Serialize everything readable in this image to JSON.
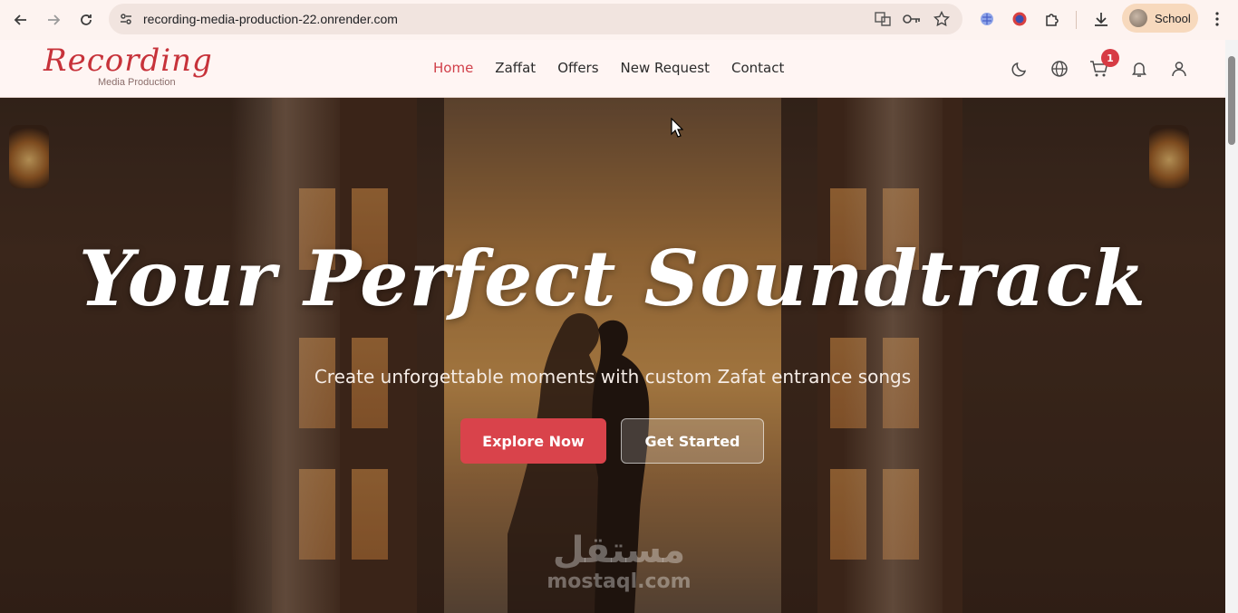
{
  "browser": {
    "url": "recording-media-production-22.onrender.com",
    "profile_label": "School"
  },
  "site": {
    "logo_text": "Recording",
    "logo_subtext": "Media Production",
    "nav": [
      {
        "label": "Home",
        "active": true
      },
      {
        "label": "Zaffat",
        "active": false
      },
      {
        "label": "Offers",
        "active": false
      },
      {
        "label": "New Request",
        "active": false
      },
      {
        "label": "Contact",
        "active": false
      }
    ],
    "cart_count": "1"
  },
  "hero": {
    "title": "Your Perfect Soundtrack",
    "subtitle": "Create unforgettable moments with custom Zafat entrance songs",
    "primary_button": "Explore Now",
    "secondary_button": "Get Started"
  },
  "watermark": {
    "arabic": "مستقل",
    "latin": "mostaql.com"
  },
  "colors": {
    "accent": "#d9434b",
    "active_nav": "#d1404a",
    "header_bg": "#fff5f3"
  }
}
